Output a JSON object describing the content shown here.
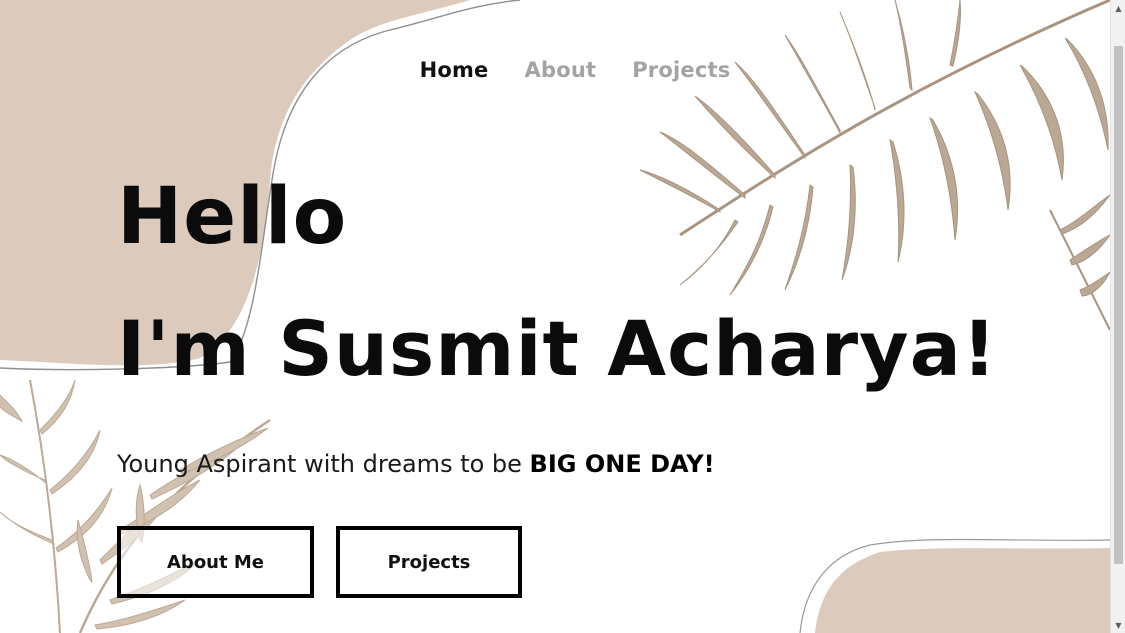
{
  "nav": {
    "items": [
      {
        "label": "Home",
        "active": true
      },
      {
        "label": "About",
        "active": false
      },
      {
        "label": "Projects",
        "active": false
      }
    ]
  },
  "hero": {
    "greeting": "Hello",
    "name_line": "I'm Susmit Acharya!",
    "tagline_prefix": "Young Aspirant with dreams to be ",
    "tagline_emphasis": "BIG ONE DAY!"
  },
  "buttons": {
    "about_label": "About Me",
    "projects_label": "Projects"
  },
  "colors": {
    "accent_beige": "#dccbbd",
    "leaf_brown": "#a48f79",
    "text_dark": "#0b0b0b",
    "nav_inactive": "#a3a3a3"
  },
  "scrollbar": {
    "up_icon": "arrow-up-icon",
    "down_icon": "arrow-down-icon"
  }
}
